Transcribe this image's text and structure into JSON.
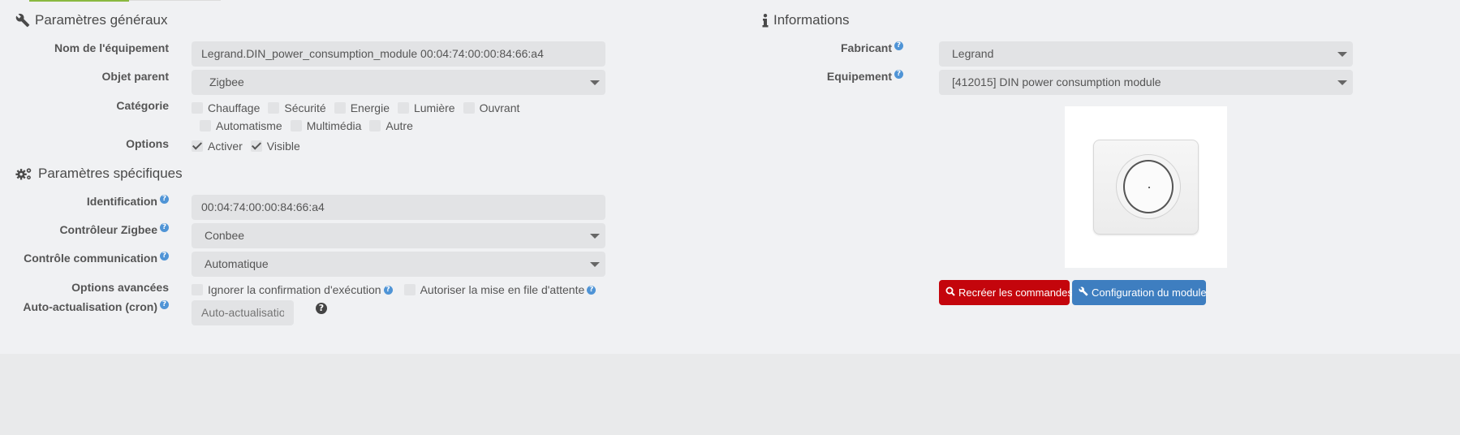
{
  "general": {
    "title": "Paramètres généraux",
    "name_label": "Nom de l'équipement",
    "name_value": "Legrand.DIN_power_consumption_module 00:04:74:00:00:84:66:a4",
    "parent_label": "Objet parent",
    "parent_value": "Zigbee",
    "category_label": "Catégorie",
    "categories": [
      {
        "label": "Chauffage",
        "checked": false
      },
      {
        "label": "Sécurité",
        "checked": false
      },
      {
        "label": "Energie",
        "checked": false
      },
      {
        "label": "Lumière",
        "checked": false
      },
      {
        "label": "Ouvrant",
        "checked": false
      },
      {
        "label": "Automatisme",
        "checked": false
      },
      {
        "label": "Multimédia",
        "checked": false
      },
      {
        "label": "Autre",
        "checked": false
      }
    ],
    "options_label": "Options",
    "options": [
      {
        "label": "Activer",
        "checked": true
      },
      {
        "label": "Visible",
        "checked": true
      }
    ]
  },
  "specific": {
    "title": "Paramètres spécifiques",
    "identification_label": "Identification",
    "identification_value": "00:04:74:00:00:84:66:a4",
    "controller_label": "Contrôleur Zigbee",
    "controller_value": "Conbee",
    "comm_label": "Contrôle communication",
    "comm_value": "Automatique",
    "advanced_label": "Options avancées",
    "advanced_options": [
      {
        "label": "Ignorer la confirmation d'exécution",
        "checked": false
      },
      {
        "label": "Autoriser la mise en file d'attente",
        "checked": false
      }
    ],
    "cron_label": "Auto-actualisation (cron)",
    "cron_placeholder": "Auto-actualisation"
  },
  "info": {
    "title": "Informations",
    "manufacturer_label": "Fabricant",
    "manufacturer_value": "Legrand",
    "equipment_label": "Equipement",
    "equipment_value": "[412015] DIN power consumption module",
    "recreate_button": "Recréer les commandes",
    "config_button": "Configuration du module"
  },
  "colors": {
    "accent_green": "#8ab940",
    "danger_red": "#c4050c",
    "primary_blue": "#3e7ec0",
    "help_blue": "#4f94d6"
  },
  "icons": {
    "general": "wrench-icon",
    "specific": "gears-icon",
    "info": "info-icon",
    "help": "question-circle-icon",
    "search": "search-icon",
    "config": "wrench-icon"
  }
}
